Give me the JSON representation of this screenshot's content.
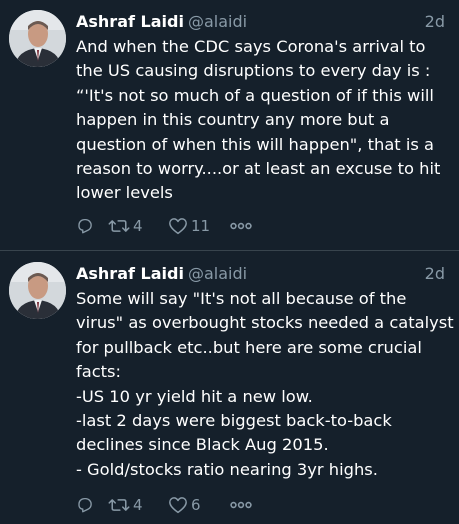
{
  "tweets": [
    {
      "author_name": "Ashraf Laidi",
      "handle": "@alaidi",
      "time": "2d",
      "text": "And when the CDC says Corona's arrival to the US causing disruptions to every day is : “'It's not so much of a question of if this will happen in this country any more but a question of when this will happen\", that is a reason to worry....or at least an excuse to hit lower levels",
      "retweets": "4",
      "likes": "11"
    },
    {
      "author_name": "Ashraf Laidi",
      "handle": "@alaidi",
      "time": "2d",
      "text": "Some will say \"It's not all because of the virus\" as overbought stocks needed a catalyst for pullback etc..but here are some crucial facts:\n-US 10 yr yield hit a new low.\n-last 2 days were biggest back-to-back declines since Black Aug 2015.\n- Gold/stocks ratio nearing 3yr highs.",
      "retweets": "4",
      "likes": "6"
    }
  ],
  "icons": {
    "reply": "reply-icon",
    "retweet": "retweet-icon",
    "like": "heart-icon",
    "more": "more-icon"
  },
  "colors": {
    "background": "#15202b",
    "text": "#ffffff",
    "secondary": "#8899a6",
    "divider": "#38444d"
  }
}
